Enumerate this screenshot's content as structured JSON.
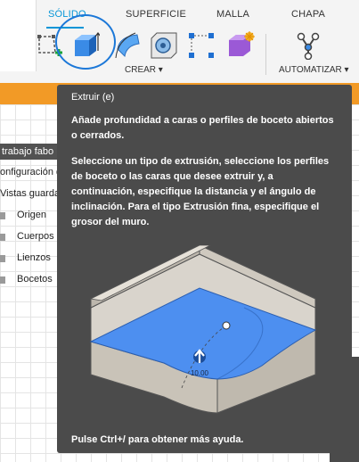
{
  "ribbon": {
    "tabs": [
      {
        "label": "SÓLIDO",
        "active": true
      },
      {
        "label": "SUPERFICIE"
      },
      {
        "label": "MALLA"
      },
      {
        "label": "CHAPA"
      }
    ],
    "groups": {
      "create_label": "CREAR ▾",
      "automate_label": "AUTOMATIZAR ▾"
    },
    "tools": [
      "sketch-create-icon",
      "extrude-icon",
      "revolve-icon",
      "hole-icon",
      "pattern-icon",
      "shell-icon",
      "automate-icon"
    ],
    "accent": "#0696d7"
  },
  "browser": {
    "header": "trabajo fabo",
    "rows": [
      "onfiguración d",
      "Vistas guardad"
    ],
    "items": [
      "Origen",
      "Cuerpos",
      "Lienzos",
      "Bocetos"
    ]
  },
  "tooltip": {
    "title": "Extruir (e)",
    "para1": "Añade profundidad a caras o perfiles de boceto abiertos o cerrados.",
    "para2": "Seleccione un tipo de extrusión, seleccione los perfiles de boceto o las caras que desee extruir y, a continuación, especifique la distancia y el ángulo de inclinación. Para el tipo Extrusión fina, especifique el grosor del muro.",
    "dimension": "10.00",
    "help": "Pulse Ctrl+/ para obtener más ayuda."
  },
  "colors": {
    "tooltip_bg": "#4b4b4b",
    "highlight_orange": "#f29a26",
    "face_blue": "#4d8ff0"
  }
}
